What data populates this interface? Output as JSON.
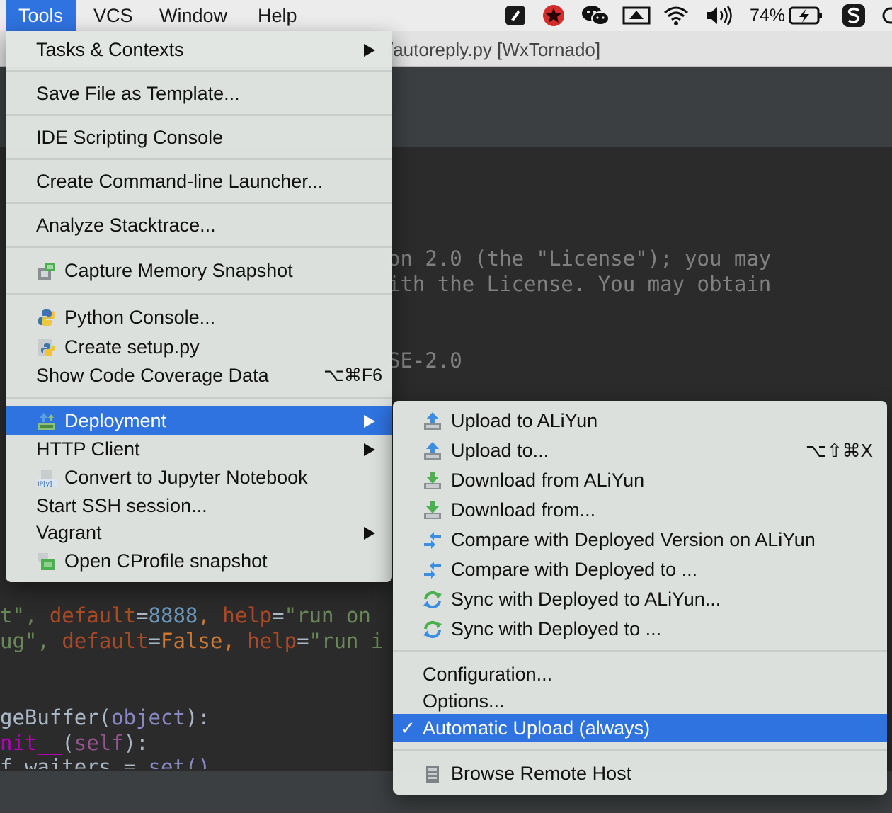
{
  "menubar": {
    "items": [
      "Tools",
      "VCS",
      "Window",
      "Help"
    ],
    "battery": "74%"
  },
  "editor": {
    "title": "/autoreply.py [WxTornado]",
    "code_lines": {
      "l1": "on 2.0 (the \"License\"); you may",
      "l2": "ith the License. You may obtain",
      "l3": "SE-2.0",
      "l4a": "t\", ",
      "l4b": "default",
      "l4c": "=",
      "l4d": "8888",
      "l4e": ", ",
      "l4f": "help",
      "l4g": "=",
      "l4h": "\"run on ",
      "l5a": "ug\", ",
      "l5b": "default",
      "l5c": "=",
      "l5d": "False",
      "l5e": ", ",
      "l5f": "help",
      "l5g": "=",
      "l5h": "\"run i",
      "l6a": "geBuffer(",
      "l6b": "object",
      "l6c": "):",
      "l7a": "nit__",
      "l7b": "(",
      "l7c": "self",
      "l7d": "):",
      "l8a": "f.waiters = ",
      "l8b": "set()"
    }
  },
  "tools_menu": {
    "tasks_contexts": "Tasks & Contexts",
    "save_template": "Save File as Template...",
    "ide_scripting": "IDE Scripting Console",
    "cmdline_launcher": "Create Command-line Launcher...",
    "analyze_stacktrace": "Analyze Stacktrace...",
    "capture_memory": "Capture Memory Snapshot",
    "python_console": "Python Console...",
    "create_setup": "Create setup.py",
    "code_coverage": "Show Code Coverage Data",
    "code_coverage_shortcut": "⌥⌘F6",
    "deployment": "Deployment",
    "http_client": "HTTP Client",
    "jupyter": "Convert to Jupyter Notebook",
    "ssh": "Start SSH session...",
    "vagrant": "Vagrant",
    "cprofile": "Open CProfile snapshot"
  },
  "deploy_menu": {
    "upload_aliyun": "Upload to ALiYun",
    "upload_to": "Upload to...",
    "upload_to_shortcut": "⌥⇧⌘X",
    "download_aliyun": "Download from ALiYun",
    "download_from": "Download from...",
    "compare_aliyun": "Compare with Deployed Version on ALiYun",
    "compare_to": "Compare with Deployed to ...",
    "sync_aliyun": "Sync with Deployed to ALiYun...",
    "sync_to": "Sync with Deployed to ...",
    "configuration": "Configuration...",
    "options": "Options...",
    "auto_upload": "Automatic Upload (always)",
    "auto_upload_check": "✓",
    "browse_remote": "Browse Remote Host"
  },
  "colors": {
    "highlight": "#2f73e0",
    "menu_bg": "#e2e6e2",
    "editor_bg": "#2b2b2b"
  }
}
